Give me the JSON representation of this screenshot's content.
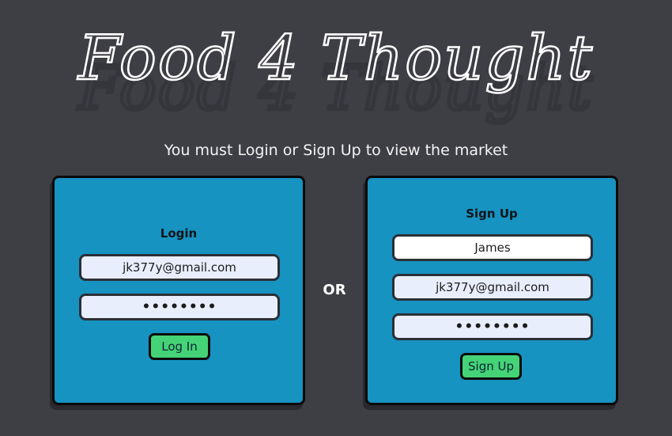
{
  "header": {
    "title": "Food 4 Thought",
    "subtitle": "You must Login or Sign Up to view the market"
  },
  "login": {
    "heading": "Login",
    "email_value": "jk377y@gmail.com",
    "password_value": "••••••••",
    "button_label": "Log In"
  },
  "divider": {
    "label": "OR"
  },
  "signup": {
    "heading": "Sign Up",
    "name_value": "James",
    "email_value": "jk377y@gmail.com",
    "password_value": "••••••••",
    "button_label": "Sign Up"
  },
  "colors": {
    "background": "#3e3e45",
    "card": "#1693c1",
    "button": "#44d477",
    "input": "#e8eefb"
  }
}
